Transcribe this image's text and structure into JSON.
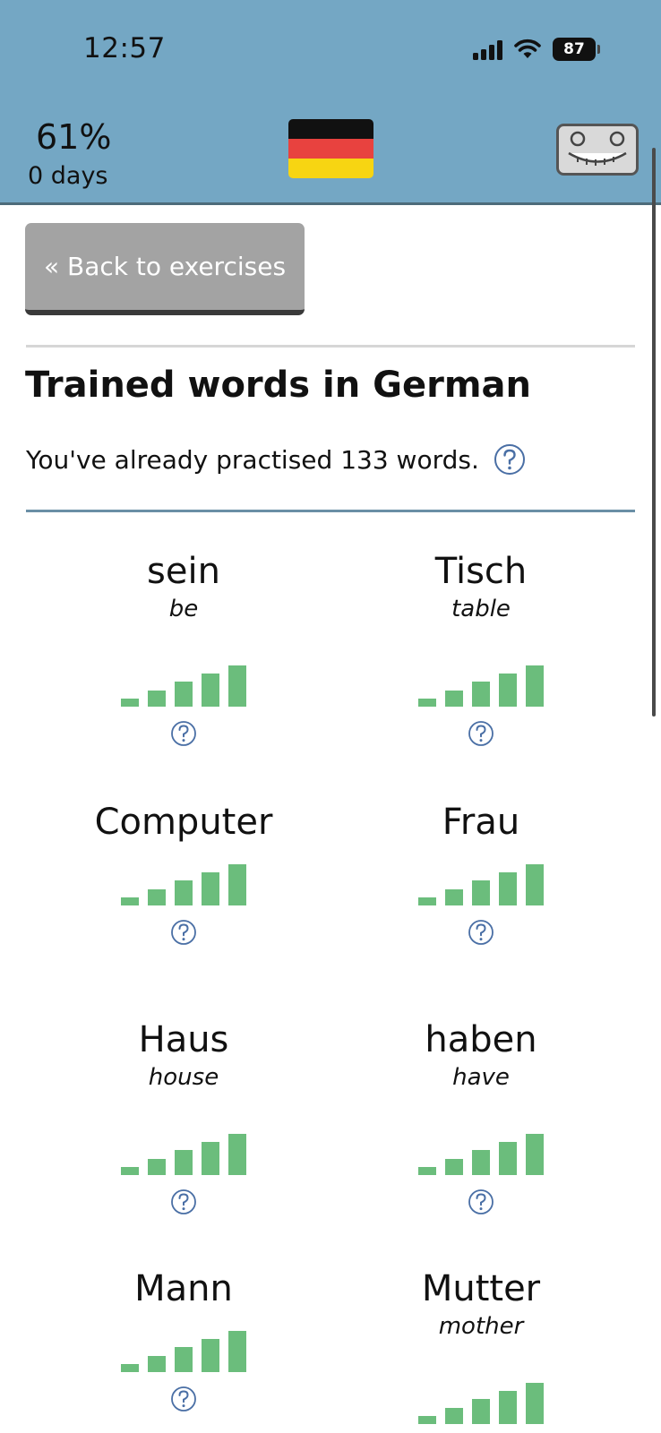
{
  "status_bar": {
    "time": "12:57",
    "battery": "87"
  },
  "header": {
    "progress": "61%",
    "streak": "0 days",
    "language_flag": "germany-flag",
    "colors": {
      "bar": "#74a7c4"
    }
  },
  "back_button": {
    "label": "« Back to exercises"
  },
  "section": {
    "title": "Trained words in German",
    "subtitle": "You've already practised 133 words."
  },
  "words": [
    {
      "word": "sein",
      "translation": "be",
      "strength": 5
    },
    {
      "word": "Tisch",
      "translation": "table",
      "strength": 5
    },
    {
      "word": "Computer",
      "translation": "",
      "strength": 5
    },
    {
      "word": "Frau",
      "translation": "",
      "strength": 5
    },
    {
      "word": "Haus",
      "translation": "house",
      "strength": 5
    },
    {
      "word": "haben",
      "translation": "have",
      "strength": 5
    },
    {
      "word": "Mann",
      "translation": "",
      "strength": 5
    },
    {
      "word": "Mutter",
      "translation": "mother",
      "strength": 5
    }
  ],
  "colors": {
    "bar_fill": "#6bbd7c",
    "help_icon": "#4a6fa5"
  }
}
